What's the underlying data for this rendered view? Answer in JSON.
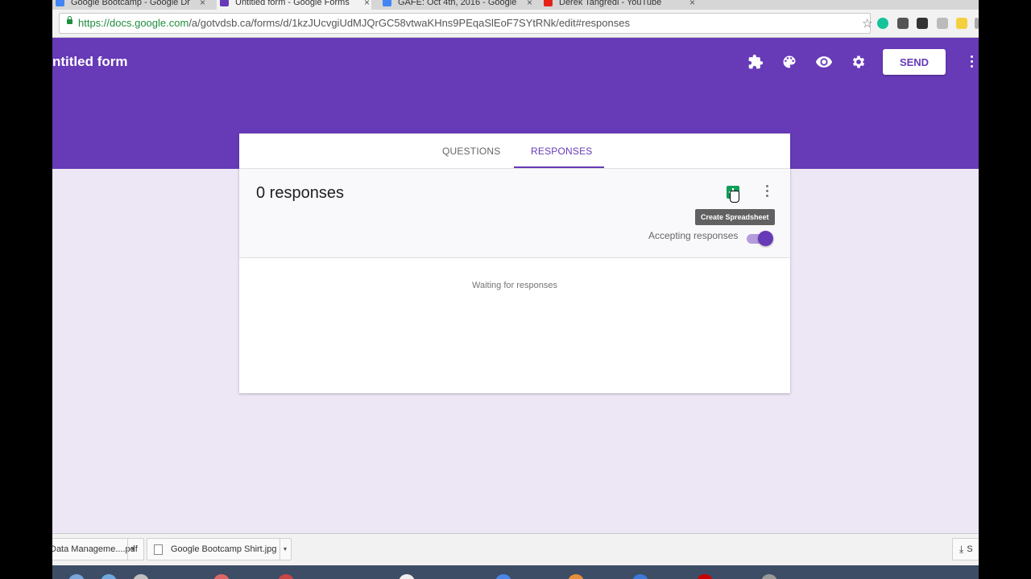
{
  "browser": {
    "tabs": [
      {
        "label": "Google Bootcamp - Google Dr",
        "close": "×"
      },
      {
        "label": "Untitled form - Google Forms",
        "close": "×"
      },
      {
        "label": "GAFE: Oct 4th, 2016 - Google",
        "close": "×"
      },
      {
        "label": "Derek Tangredi - YouTube",
        "close": "×"
      }
    ],
    "url_host": "https://docs.google.com",
    "url_path": "/a/gotvdsb.ca/forms/d/1kzJUcvgiUdMJQrGC58vtwaKHns9PEqaSlEoF7SYtRNk/edit#responses"
  },
  "form": {
    "title": "ntitled form",
    "send_label": "SEND",
    "tabs": [
      "QUESTIONS",
      "RESPONSES"
    ],
    "response_count": "0 responses",
    "tooltip": "Create Spreadsheet",
    "accepting_label": "Accepting responses",
    "accepting": true,
    "waiting": "Waiting for responses"
  },
  "downloads": [
    {
      "name": "Data Manageme....pdf"
    },
    {
      "name": "Google Bootcamp Shirt.jpg"
    }
  ],
  "downloads_show_all": "S",
  "colors": {
    "accent": "#673ab7",
    "background": "#ece6f5",
    "sheets": "#0f9d58"
  },
  "icons": [
    "puzzle-icon",
    "palette-icon",
    "eye-icon",
    "gear-icon",
    "more-vert-icon",
    "spreadsheet-icon",
    "lock-icon",
    "star-icon",
    "download-icon"
  ]
}
